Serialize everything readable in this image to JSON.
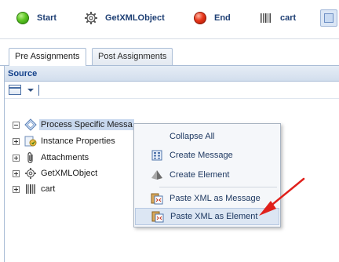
{
  "toolbar": {
    "items": [
      {
        "label": "Start",
        "icon": "green-circle-icon"
      },
      {
        "label": "GetXMLObject",
        "icon": "gear-icon"
      },
      {
        "label": "End",
        "icon": "red-circle-icon"
      },
      {
        "label": "cart",
        "icon": "barcode-icon"
      }
    ]
  },
  "tabs": [
    {
      "label": "Pre Assignments",
      "active": true
    },
    {
      "label": "Post Assignments",
      "active": false
    }
  ],
  "panel": {
    "title": "Source"
  },
  "tree": {
    "items": [
      {
        "label": "Process Specific Messa",
        "icon": "diamond-message-icon",
        "expanded": true,
        "selected": true
      },
      {
        "label": "Instance Properties",
        "icon": "instance-properties-icon",
        "expanded": false
      },
      {
        "label": "Attachments",
        "icon": "paperclip-icon",
        "expanded": false
      },
      {
        "label": "GetXMLObject",
        "icon": "gear-icon",
        "expanded": false
      },
      {
        "label": "cart",
        "icon": "barcode-icon",
        "expanded": false
      }
    ]
  },
  "context_menu": {
    "items": [
      {
        "label": "Collapse All",
        "icon": ""
      },
      {
        "label": "Create Message",
        "icon": "message-grid-icon"
      },
      {
        "label": "Create Element",
        "icon": "pyramid-icon"
      },
      {
        "label": "Paste XML as Message",
        "icon": "paste-xml-icon"
      },
      {
        "label": "Paste XML as Element",
        "icon": "paste-xml-icon",
        "hovered": true
      }
    ]
  },
  "colors": {
    "accent": "#1e3f74",
    "panel_header": "#15428b",
    "arrow": "#e0201b",
    "selection": "#c8d8ee"
  }
}
